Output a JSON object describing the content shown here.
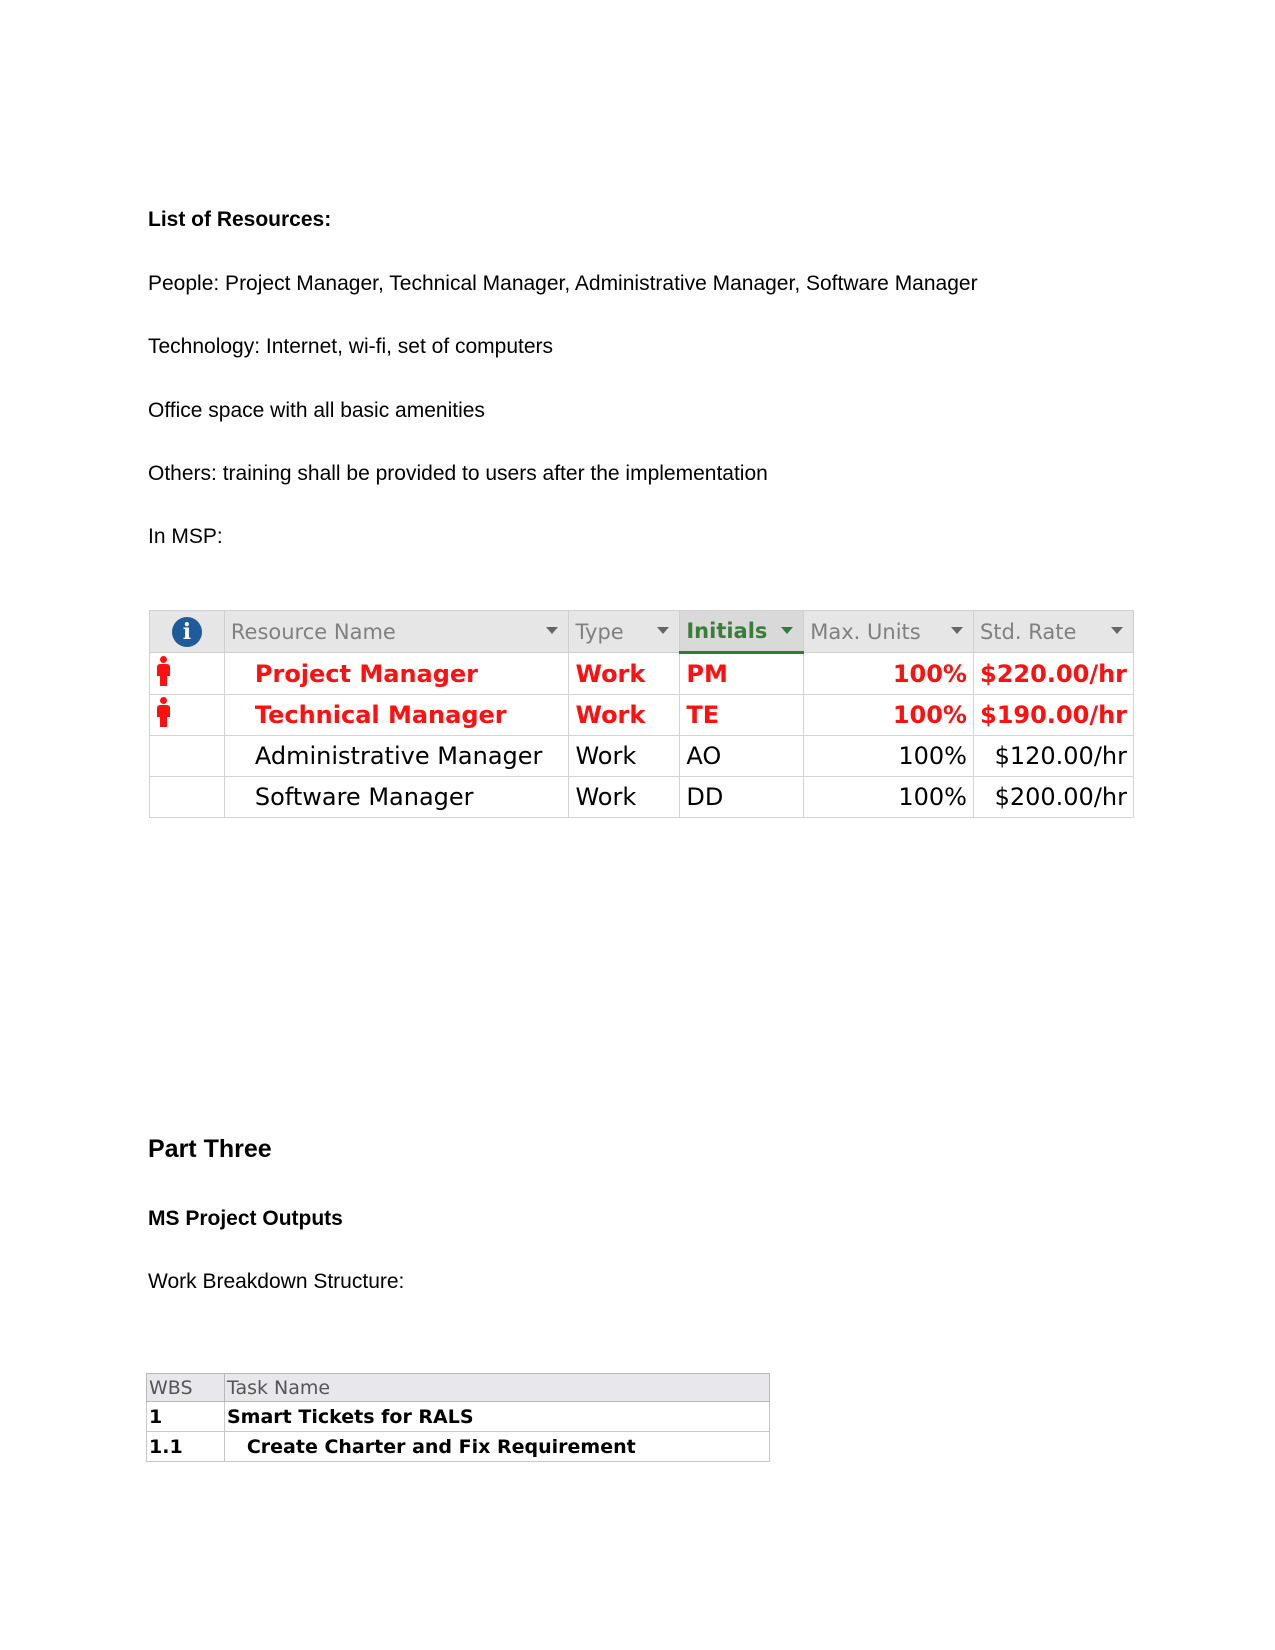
{
  "section_title": "List of Resources:",
  "paragraphs": {
    "people": "People: Project Manager, Technical Manager, Administrative Manager, Software Manager",
    "technology": "Technology: Internet, wi-fi, set of computers",
    "office": "Office space with all basic amenities",
    "others": "Others: training shall be provided to users after the implementation",
    "in_msp": "In MSP:"
  },
  "resource_table": {
    "headers": {
      "indicator": "info-icon",
      "resource_name": "Resource Name",
      "type": "Type",
      "initials": "Initials",
      "max_units": "Max. Units",
      "std_rate": "Std. Rate"
    },
    "rows": [
      {
        "overallocated": true,
        "name": "Project Manager",
        "type": "Work",
        "initials": "PM",
        "max_units": "100%",
        "std_rate": "$220.00/hr"
      },
      {
        "overallocated": true,
        "name": "Technical Manager",
        "type": "Work",
        "initials": "TE",
        "max_units": "100%",
        "std_rate": "$190.00/hr"
      },
      {
        "overallocated": false,
        "name": "Administrative Manager",
        "type": "Work",
        "initials": "AO",
        "max_units": "100%",
        "std_rate": "$120.00/hr"
      },
      {
        "overallocated": false,
        "name": "Software Manager",
        "type": "Work",
        "initials": "DD",
        "max_units": "100%",
        "std_rate": "$200.00/hr"
      }
    ],
    "colors": {
      "overallocated": "#ff1010",
      "sorted_header": "#2e7d32",
      "info_icon": "#1f5b9a"
    }
  },
  "part_three": {
    "title": "Part Three",
    "subtitle": "MS Project Outputs",
    "wbs_label": "Work Breakdown Structure:"
  },
  "wbs_table": {
    "headers": {
      "wbs": "WBS",
      "task_name": "Task Name"
    },
    "rows": [
      {
        "wbs": "1",
        "task_name": "Smart Tickets for RALS"
      },
      {
        "wbs": "1.1",
        "task_name": "   Create Charter and Fix Requirement"
      }
    ]
  }
}
